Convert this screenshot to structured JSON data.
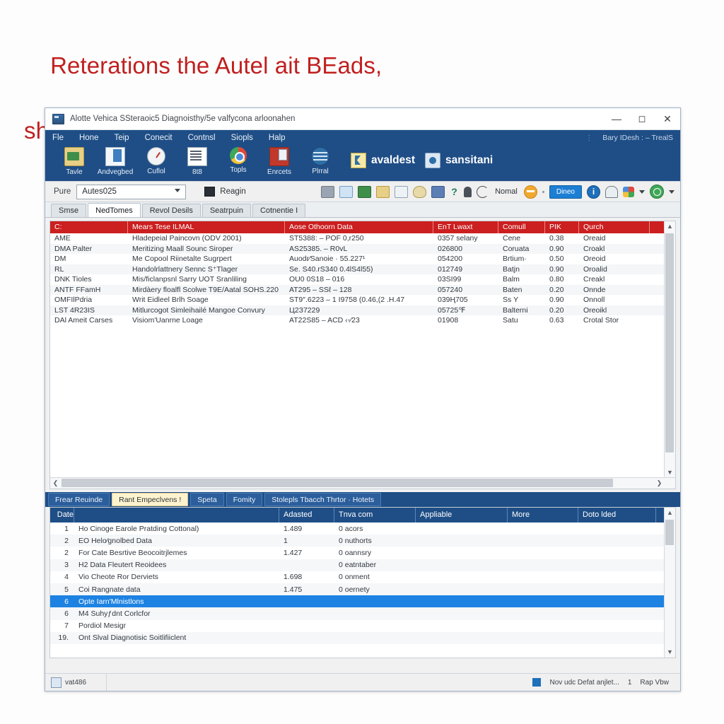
{
  "heading": {
    "line1": "Reterations the Autel ait BEads,",
    "line2": "shaa dlate arounumorıiG vehicle the InoGIA sonool",
    "color": "#c0201f"
  },
  "window": {
    "title": "Alotte Vehica SSteraoic5 Diagnoisthy/5e valfycona arloonahen",
    "controls": {
      "minimize": "—",
      "maximize": "☐",
      "close": "✕"
    },
    "menu": [
      "Fle",
      "Hone",
      "Teip",
      "Conecit",
      "Contnsl",
      "Siopls",
      "Halp"
    ],
    "menu_right": {
      "mark": "⋮",
      "text": "Bary IDesh : – TrealS"
    },
    "toolbar": [
      {
        "label": "Tavle",
        "icon": "folder-icon"
      },
      {
        "label": "Andvegbed",
        "icon": "document-icon"
      },
      {
        "label": "Cuflol",
        "icon": "gauge-icon"
      },
      {
        "label": "8t8",
        "icon": "list-icon"
      },
      {
        "label": "Topls",
        "icon": "chrome-icon"
      },
      {
        "label": "Enrcets",
        "icon": "box-icon"
      },
      {
        "label": "Plrral",
        "icon": "globe-icon"
      }
    ],
    "brands": [
      {
        "label": "avaldest",
        "icon": "avaldest-logo-icon"
      },
      {
        "label": "sansitani",
        "icon": "sansitani-logo-icon"
      }
    ],
    "control_bar": {
      "label": "Pure",
      "combo_value": "Autes025",
      "button": "Reagin",
      "status_text": "Nomal",
      "blue_button": "Dineo",
      "icons": [
        "camera-icon",
        "wave-icon",
        "green-card-icon",
        "folder-icon",
        "window-icon",
        "cloud-icon",
        "stack-icon",
        "help-icon",
        "bell-icon",
        "nav-icon",
        "orange-circle-icon",
        "info-icon",
        "alert-icon",
        "pinwheel-icon",
        "check-circle-icon"
      ]
    },
    "tabs": [
      {
        "label": "Smse",
        "active": false
      },
      {
        "label": "NedTomes",
        "active": true
      },
      {
        "label": "Revol Desils",
        "active": false
      },
      {
        "label": "Seatrpuin",
        "active": false
      },
      {
        "label": "Cotnentie I",
        "active": false
      }
    ]
  },
  "upper_table": {
    "headers": [
      "C:",
      "Mears Tese ILMAL",
      "Aose Othoorn Data",
      "EnT Lwaxt",
      "Comull",
      "PIK",
      "Qurch"
    ],
    "rows": [
      [
        "AME",
        "Hladepeial Paincovn (ODV 2001)",
        "ST5388: – POF 0,r250",
        "0357 selany",
        "Cene",
        "0.38",
        "Oreaid"
      ],
      [
        "DMA Palter",
        "Meritizing Maall Sounc Siroper",
        "AS25385. – R0vL",
        "026800",
        "Coruata",
        "0.90",
        "Croakl"
      ],
      [
        "DM",
        "Me Copool Riinetalte Sugrpert",
        "Auodr⁄Sanoie · 55.227¹",
        "054200",
        "Brtium·",
        "0.50",
        "Oreoid"
      ],
      [
        "RL",
        "Handolrlattnery Sennc S⁺Tlager",
        "Se. S40.rS340 0.4lS4l55)",
        "012749",
        "Batjn",
        "0.90",
        "Oroalid"
      ],
      [
        "DNK Tioles",
        "Mis/ficlanpsnl Sarry UOT Sranliling",
        "OU0 0S18 – 016",
        "03SI99",
        "Balm",
        "0.80",
        "Creakl"
      ],
      [
        "ANTF FFamH",
        "Mirdàery floalfl Scolwe T9E/Aatal SOHS.220",
        "AT295 – SSℓ – 128",
        "057240",
        "Baten",
        "0.20",
        "Onnde"
      ],
      [
        "OMFIlPdria",
        "Writ Eidleel Brlh Soage",
        "ST9″.6223 – 1 I9758 (0.46,(2 .H.47",
        "039Ң705",
        "Sѕ Y",
        "0.90",
        "Onnoll"
      ],
      [
        "LST 4R23IS",
        "Mitlurcogot Simleihailé Mangoe Convury",
        "Ц2З7229",
        "05725℉",
        "Balterni",
        "0.20",
        "Oreoikl"
      ],
      [
        "DAl Ameit Carses",
        "Visiom'Uanrne Loage",
        "AT22S85 – ACD ‹◦⁄23",
        "01908",
        "Satu",
        "0.63",
        "Crotal Stor"
      ]
    ]
  },
  "bottom_tabs": [
    {
      "label": "Frear Reuinde",
      "active": false
    },
    {
      "label": "Rant Empeclvens !",
      "active": true
    },
    {
      "label": "Speta",
      "active": false
    },
    {
      "label": "Fomity",
      "active": false
    },
    {
      "label": "Stolepls  Tbacch  Thrtor · Hotets",
      "active": false
    }
  ],
  "bottom_table": {
    "headers": [
      "Date",
      "",
      "Adasted",
      "Tnva com",
      "Appliable",
      "More",
      "Doto lded"
    ],
    "rows": [
      {
        "num": "1",
        "desc": "Ho Cinoge Earole Pratding Cottonal)",
        "adasted": "1.489",
        "tnva": "0 acors",
        "selected": false
      },
      {
        "num": "2",
        "desc": "EO Helo⁄gnolbed Data",
        "adasted": "1",
        "tnva": "0 nuthorts",
        "selected": false
      },
      {
        "num": "2",
        "desc": "For Cate Besrtive Beocoitrjlemes",
        "adasted": "1.427",
        "tnva": "0 oannsry",
        "selected": false
      },
      {
        "num": "3",
        "desc": "H2 Data Fleutert Reoidees",
        "adasted": "",
        "tnva": "0 eatntaber",
        "selected": false
      },
      {
        "num": "4",
        "desc": "Vio Cheote Ror Derviets",
        "adasted": "1.698",
        "tnva": "0 onment",
        "selected": false
      },
      {
        "num": "5",
        "desc": "Coi Rangnate data",
        "adasted": "1.475",
        "tnva": "0 oernety",
        "selected": false
      },
      {
        "num": "6",
        "desc": "Opte Iarn'Mlnistlons",
        "adasted": "",
        "tnva": "",
        "selected": true
      },
      {
        "num": "6",
        "desc": "M4 Suhyƒdnt Corlcfor",
        "adasted": "",
        "tnva": "",
        "selected": false
      },
      {
        "num": "7",
        "desc": "Pordiol Mesigr",
        "adasted": "",
        "tnva": "",
        "selected": false
      },
      {
        "num": "19.",
        "desc": "Ont Slval Diagnotisic Soitlifiiclent",
        "adasted": "",
        "tnva": "",
        "selected": false
      }
    ]
  },
  "status_bar": {
    "left_text": "vat486",
    "right_text": "Nov udc Defat anjlet...",
    "page": "1",
    "view": "Rap  Vbw"
  }
}
